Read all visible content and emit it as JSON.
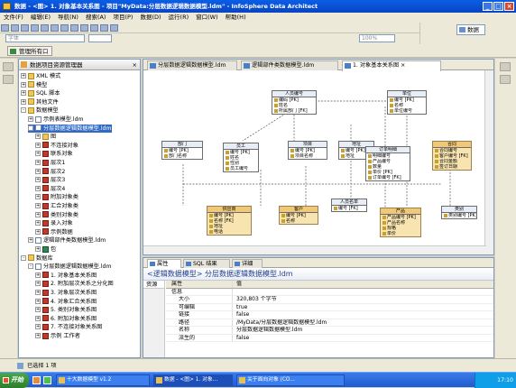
{
  "window": {
    "title": "数据 - <图> 1. 对象基本关系图 - 项目\"MyData:分层数据逻辑数据模型.ldm\" - InfoSphere Data Architect"
  },
  "menu": [
    "文件(F)",
    "编辑(E)",
    "导航(N)",
    "搜索(A)",
    "项目(P)",
    "数据(D)",
    "运行(R)",
    "窗口(W)",
    "帮助(H)"
  ],
  "toolbar": {
    "font_combo": "字体",
    "size_combo": "",
    "zoom_combo": "100%",
    "action_button": "管理所有口"
  },
  "perspective": {
    "label": "数据"
  },
  "navigator": {
    "title": "数据项目资源管理器",
    "nodes": [
      {
        "label": "XML 模式",
        "pm": "+",
        "icon": "f",
        "indent": 1
      },
      {
        "label": "模型",
        "pm": "+",
        "icon": "f",
        "indent": 1
      },
      {
        "label": "SQL 脚本",
        "pm": "+",
        "icon": "f",
        "indent": 1
      },
      {
        "label": "其他文件",
        "pm": "+",
        "icon": "f",
        "indent": 1
      },
      {
        "label": "数据模型",
        "pm": "-",
        "icon": "f",
        "indent": 1
      },
      {
        "label": "示例表模型.ldm",
        "pm": "+",
        "icon": "d",
        "indent": 2
      },
      {
        "label": "分层数据逻辑数据模型.ldm",
        "pm": "-",
        "icon": "d",
        "indent": 2,
        "sel": true
      },
      {
        "label": "图",
        "pm": "+",
        "icon": "f",
        "indent": 3
      },
      {
        "label": "不连接对象",
        "pm": "+",
        "icon": "m",
        "indent": 3
      },
      {
        "label": "联系对象",
        "pm": "+",
        "icon": "m",
        "indent": 3
      },
      {
        "label": "层次1",
        "pm": "+",
        "icon": "m",
        "indent": 3
      },
      {
        "label": "层次2",
        "pm": "+",
        "icon": "m",
        "indent": 3
      },
      {
        "label": "层次3",
        "pm": "+",
        "icon": "m",
        "indent": 3
      },
      {
        "label": "层次4",
        "pm": "+",
        "icon": "m",
        "indent": 3
      },
      {
        "label": "附加对象类",
        "pm": "+",
        "icon": "m",
        "indent": 3
      },
      {
        "label": "汇合对象类",
        "pm": "+",
        "icon": "m",
        "indent": 3
      },
      {
        "label": "类别对象类",
        "pm": "+",
        "icon": "m",
        "indent": 3
      },
      {
        "label": "录入对象",
        "pm": "+",
        "icon": "m",
        "indent": 3
      },
      {
        "label": "示例数据",
        "pm": "+",
        "icon": "m",
        "indent": 3
      },
      {
        "label": "逻辑部件类数据模型.ldm",
        "pm": "+",
        "icon": "d",
        "indent": 2
      },
      {
        "label": "包",
        "pm": "+",
        "icon": "g",
        "indent": 3
      },
      {
        "label": "数据库",
        "pm": "-",
        "icon": "f",
        "indent": 1
      },
      {
        "label": "分层数据逻辑数据模型.ldm",
        "pm": "-",
        "icon": "d",
        "indent": 2
      },
      {
        "label": "1. 对象基本关系图",
        "pm": "+",
        "icon": "m",
        "indent": 3
      },
      {
        "label": "2. 附加层次关系之分化图",
        "pm": "+",
        "icon": "m",
        "indent": 3
      },
      {
        "label": "3. 对象层次关系图",
        "pm": "+",
        "icon": "m",
        "indent": 3
      },
      {
        "label": "4. 对象汇合关系图",
        "pm": "+",
        "icon": "m",
        "indent": 3
      },
      {
        "label": "5. 类别对象关系图",
        "pm": "+",
        "icon": "m",
        "indent": 3
      },
      {
        "label": "6. 附加对象关系图",
        "pm": "+",
        "icon": "m",
        "indent": 3
      },
      {
        "label": "7. 不连接对象关系图",
        "pm": "+",
        "icon": "m",
        "indent": 3
      },
      {
        "label": "示例 工作者",
        "pm": "+",
        "icon": "m",
        "indent": 3
      }
    ]
  },
  "editor": {
    "tabs": [
      {
        "label": "分层数据逻辑数据模型.ldm",
        "active": false
      },
      {
        "label": "逻辑部件类数据模型.ldm",
        "active": false
      },
      {
        "label": "1. 对象基本关系图",
        "active": true
      }
    ],
    "entities": [
      {
        "title": "人员编号",
        "rows": [
          "编码 [PK]",
          "姓名",
          "所属部门 [FK]"
        ],
        "style": "w"
      },
      {
        "title": "部门",
        "rows": [
          "编号 [PK]",
          "部门名称"
        ],
        "style": "w"
      },
      {
        "title": "员工",
        "rows": [
          "编号 [PK]",
          "姓名",
          "性别",
          "员工编号"
        ],
        "style": "w"
      },
      {
        "title": "项目",
        "rows": [
          "编号 [PK]",
          "项目名称"
        ],
        "style": "w"
      },
      {
        "title": "地址",
        "rows": [
          "编号 [PK]",
          "地址"
        ],
        "style": "w"
      },
      {
        "title": "单位",
        "rows": [
          "编号 [PK]",
          "名称",
          "单位编号"
        ],
        "style": "w"
      },
      {
        "title": "订单明细",
        "rows": [
          "明细编号",
          "产品编号",
          "数量",
          "单价 [PK]",
          "订单编号 [FK]"
        ],
        "style": "w"
      },
      {
        "title": "合同",
        "rows": [
          "合同编号",
          "客户编号 [FK]",
          "合同金额",
          "签订日期"
        ],
        "style": "y"
      },
      {
        "title": "供应商",
        "rows": [
          "编号 [PK]",
          "名称 [FK]",
          "地址",
          "电话"
        ],
        "style": "y"
      },
      {
        "title": "客户",
        "rows": [
          "编号 [PK]",
          "名称"
        ],
        "style": "y"
      },
      {
        "title": "人员名单",
        "rows": [
          "编号 [FK]"
        ],
        "style": "w"
      },
      {
        "title": "产品",
        "rows": [
          "产品编号 [PK]",
          "产品名称",
          "规格",
          "单价"
        ],
        "style": "y"
      },
      {
        "title": "类别",
        "rows": [
          "类别编号 [PK]"
        ],
        "style": "w"
      }
    ]
  },
  "properties": {
    "tabs": [
      {
        "label": "属性",
        "active": true
      },
      {
        "label": "SQL 结果",
        "active": false
      },
      {
        "label": "详细",
        "active": false
      }
    ],
    "title": "<逻辑数据模型> 分层数据逻辑数据模型.ldm",
    "side": [
      "资源"
    ],
    "header": {
      "k": "属性",
      "v": "值"
    },
    "group": "信息",
    "rows": [
      {
        "k": "大小",
        "v": "320,803 个字节"
      },
      {
        "k": "可编辑",
        "v": "true"
      },
      {
        "k": "链接",
        "v": "false"
      },
      {
        "k": "路径",
        "v": "/MyData/分层数据逻辑数据模型.ldm"
      },
      {
        "k": "名称",
        "v": "分层数据逻辑数据模型.ldm"
      },
      {
        "k": "派生的",
        "v": "false"
      }
    ]
  },
  "status": {
    "text": "已选择 1 项"
  },
  "taskbar": {
    "start": "开始",
    "tasks": [
      {
        "label": "十大数据模型 v1.2"
      },
      {
        "label": "数据 - <图> 1. 对象..."
      },
      {
        "label": "关于面向对象 (CO..."
      }
    ],
    "clock": "17:10"
  },
  "colors": {
    "title_bar": "#0a5ee6",
    "selection": "#316ac5",
    "entity_yellow": "#f8e4b0",
    "taskbar": "#1f5bd0"
  }
}
